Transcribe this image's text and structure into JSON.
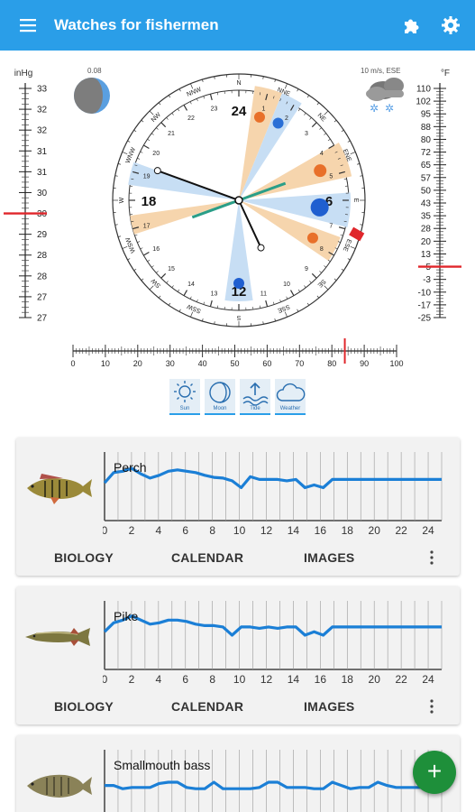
{
  "appbar": {
    "title": "Watches for fishermen",
    "menu_icon": "hamburger-menu-icon",
    "plugin_icon": "puzzle-icon",
    "settings_icon": "gear-icon"
  },
  "pressure": {
    "unit": "inHg",
    "ticks": [
      "33",
      "32",
      "32",
      "31",
      "31",
      "30",
      "30",
      "29",
      "28",
      "28",
      "27",
      "27"
    ],
    "current_tick_index": 6
  },
  "temperature": {
    "unit": "°F",
    "ticks": [
      "110",
      "102",
      "95",
      "88",
      "80",
      "72",
      "65",
      "57",
      "50",
      "43",
      "35",
      "28",
      "20",
      "13",
      "5",
      "-3",
      "-10",
      "-17",
      "-25"
    ],
    "current_tick_index": 14
  },
  "moon": {
    "value_label": "0.08"
  },
  "weather": {
    "label": "10 m/s, ESE",
    "icon": "cloud-snow-icon"
  },
  "clock": {
    "hour_labels": [
      {
        "h": "24",
        "big": true
      },
      {
        "h": "6",
        "big": true
      },
      {
        "h": "12",
        "big": true
      },
      {
        "h": "18",
        "big": true
      }
    ],
    "small_hours": [
      "1",
      "2",
      "3",
      "4",
      "5",
      "7",
      "8",
      "9",
      "10",
      "11",
      "13",
      "14",
      "15",
      "16",
      "17",
      "19",
      "20",
      "21",
      "22",
      "23"
    ],
    "directions": [
      "N",
      "NNE",
      "NE",
      "ENE",
      "E",
      "ESE",
      "SE",
      "SSE",
      "S",
      "SSW",
      "SW",
      "WSW",
      "W",
      "WNW",
      "NW",
      "NNW"
    ]
  },
  "scale": {
    "labels": [
      "0",
      "10",
      "20",
      "30",
      "40",
      "50",
      "60",
      "70",
      "80",
      "90",
      "100"
    ],
    "marker_value": 84
  },
  "modes": [
    {
      "label": "Sun",
      "icon": "sun-icon"
    },
    {
      "label": "Moon",
      "icon": "moon-icon"
    },
    {
      "label": "Tide",
      "icon": "tide-icon"
    },
    {
      "label": "Weather",
      "icon": "cloud-icon"
    }
  ],
  "x_hours": [
    "0",
    "2",
    "4",
    "6",
    "8",
    "10",
    "12",
    "14",
    "16",
    "18",
    "20",
    "22",
    "24"
  ],
  "fish_cards": [
    {
      "name": "Perch",
      "biology": "BIOLOGY",
      "calendar": "CALENDAR",
      "images": "IMAGES",
      "activity": [
        0.55,
        0.7,
        0.72,
        0.76,
        0.68,
        0.62,
        0.66,
        0.72,
        0.74,
        0.72,
        0.7,
        0.66,
        0.63,
        0.62,
        0.58,
        0.48,
        0.64,
        0.6,
        0.6,
        0.6,
        0.58,
        0.6,
        0.48,
        0.52,
        0.48,
        0.6,
        0.6,
        0.6,
        0.6,
        0.6,
        0.6,
        0.6,
        0.6,
        0.6,
        0.6,
        0.6,
        0.6,
        0.6
      ]
    },
    {
      "name": "Pike",
      "biology": "BIOLOGY",
      "calendar": "CALENDAR",
      "images": "IMAGES",
      "activity": [
        0.55,
        0.68,
        0.72,
        0.78,
        0.72,
        0.66,
        0.68,
        0.72,
        0.72,
        0.7,
        0.66,
        0.64,
        0.64,
        0.62,
        0.5,
        0.62,
        0.62,
        0.6,
        0.62,
        0.6,
        0.62,
        0.62,
        0.5,
        0.55,
        0.5,
        0.62,
        0.62,
        0.62,
        0.62,
        0.62,
        0.62,
        0.62,
        0.62,
        0.62,
        0.62,
        0.62,
        0.62,
        0.62
      ]
    },
    {
      "name": "Smallmouth bass",
      "activity": [
        0.45,
        0.45,
        0.4,
        0.42,
        0.42,
        0.42,
        0.48,
        0.5,
        0.5,
        0.42,
        0.4,
        0.4,
        0.5,
        0.4,
        0.4,
        0.4,
        0.4,
        0.42,
        0.5,
        0.5,
        0.42,
        0.42,
        0.42,
        0.4,
        0.4,
        0.5,
        0.45,
        0.4,
        0.42,
        0.42,
        0.5,
        0.45,
        0.42,
        0.42,
        0.42,
        0.42,
        0.42,
        0.42
      ]
    }
  ],
  "colors": {
    "accent": "#2a9ee8",
    "sun_sector": "#f6d5ad",
    "moon_sector": "#c7def4",
    "activity_line": "#1b7fd6",
    "fab": "#1e8f3a"
  }
}
